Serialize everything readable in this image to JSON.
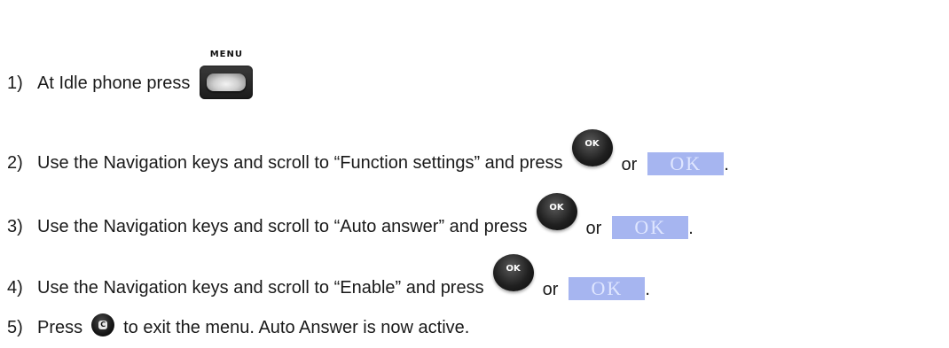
{
  "steps": [
    {
      "number": "1)",
      "text": "At Idle phone press"
    },
    {
      "number": "2)",
      "text": "Use the Navigation keys and scroll to “Function settings” and press",
      "or": "or",
      "end": "."
    },
    {
      "number": "3)",
      "text": "Use the Navigation keys and scroll to “Auto answer” and press",
      "or": "or",
      "end": "."
    },
    {
      "number": "4)",
      "text": "Use the Navigation keys and scroll to “Enable” and press",
      "or": "or",
      "end": "."
    },
    {
      "number": "5)",
      "text_before": "Press",
      "text_after": "to exit the menu. Auto Answer is now active."
    }
  ],
  "keys": {
    "menu_label": "MENU",
    "ok_round_label": "OK",
    "ok_soft_label": "OK",
    "c_key_label": "C"
  },
  "colors": {
    "ok_soft_bg": "#a6b5f0",
    "ok_soft_text": "#dfe6ff"
  },
  "icons": [
    "menu-key-icon",
    "ok-round-key-icon",
    "ok-softkey-icon",
    "c-key-icon"
  ]
}
